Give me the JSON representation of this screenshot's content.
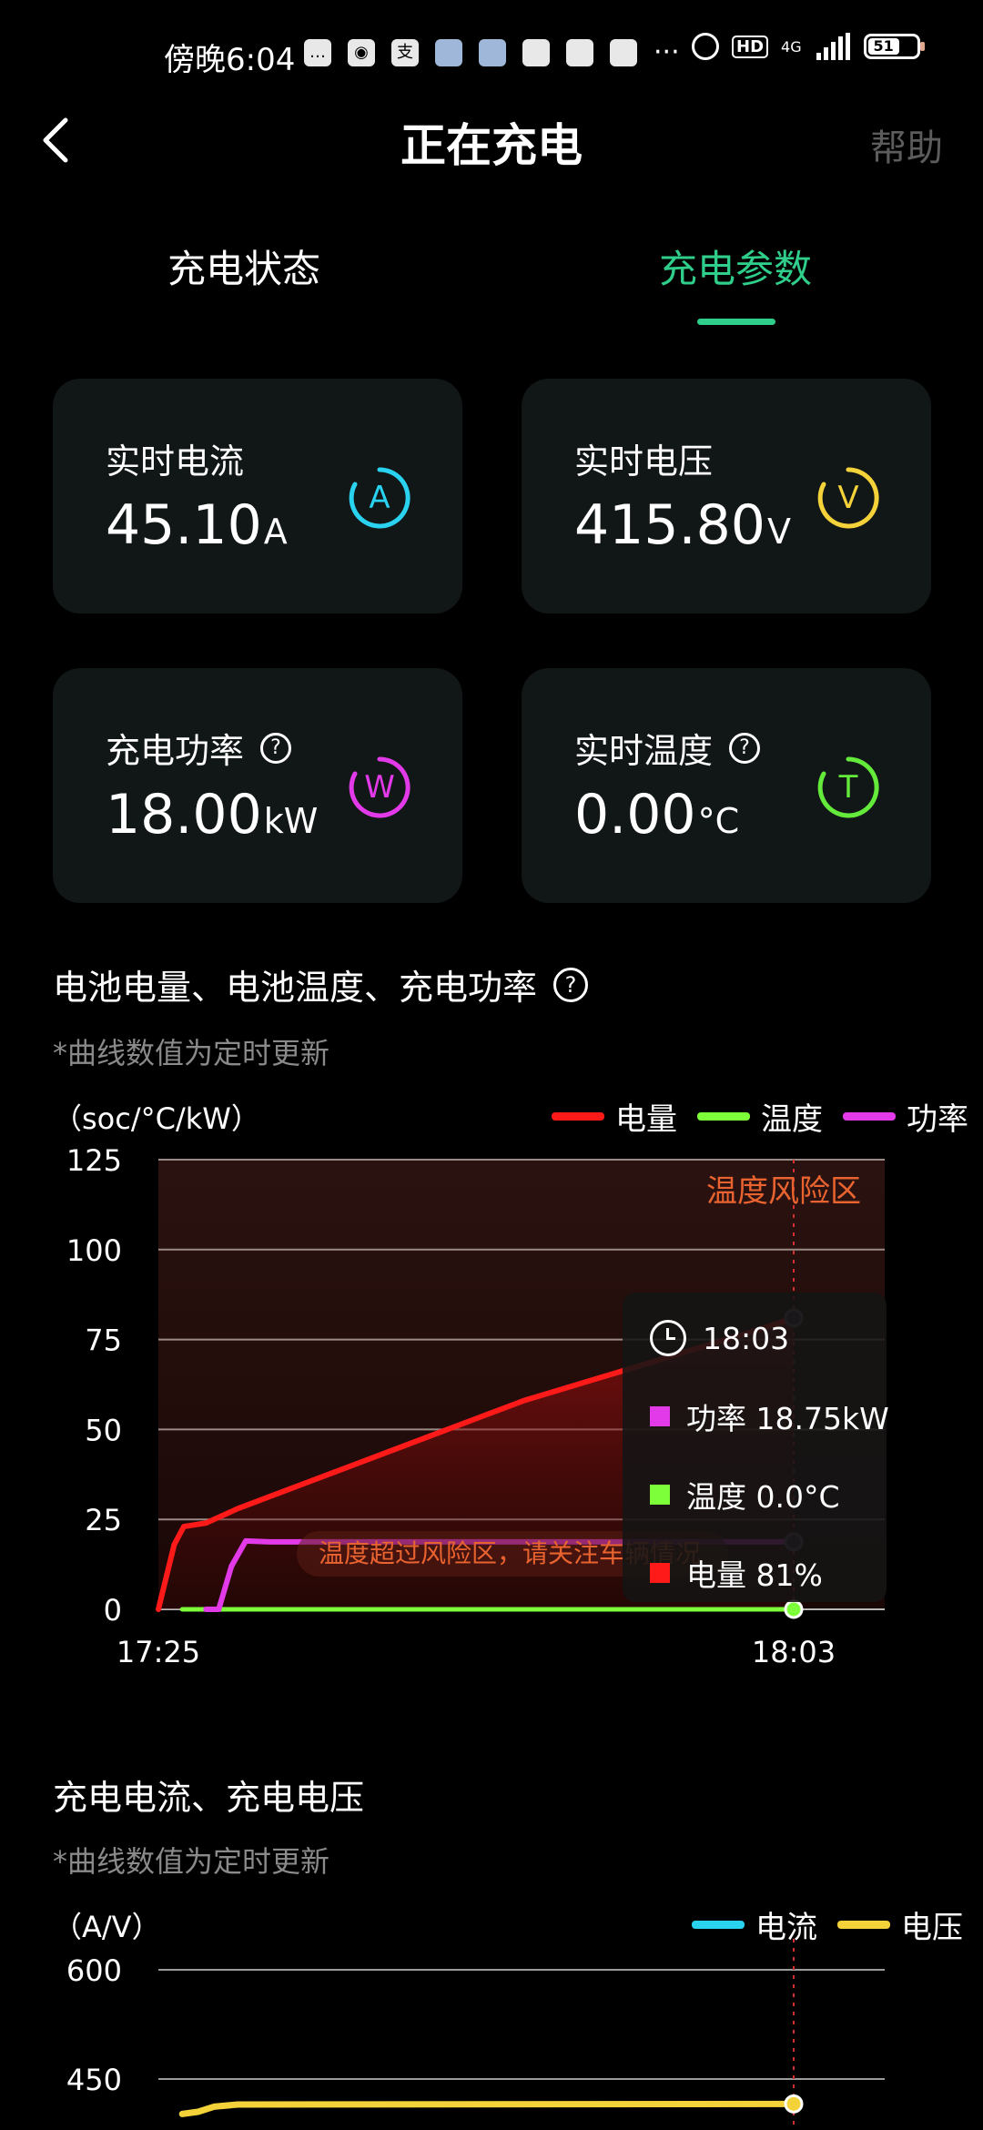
{
  "status_bar": {
    "time": "傍晚6:04",
    "network": "4G",
    "hd": "HD",
    "battery_level": "51"
  },
  "header": {
    "title": "正在充电",
    "help": "帮助"
  },
  "tabs": [
    {
      "label": "充电状态",
      "active": false
    },
    {
      "label": "充电参数",
      "active": true
    }
  ],
  "cards": {
    "current": {
      "label": "实时电流",
      "value": "45.10",
      "unit": "A",
      "icon": "A",
      "color": "#29d3f0"
    },
    "voltage": {
      "label": "实时电压",
      "value": "415.80",
      "unit": "V",
      "icon": "V",
      "color": "#f4d23a"
    },
    "power": {
      "label": "充电功率",
      "value": "18.00",
      "unit": "kW",
      "icon": "W",
      "color": "#e23ae8"
    },
    "temperature": {
      "label": "实时温度",
      "value": "0.00",
      "unit": "°C",
      "icon": "T",
      "color": "#63ea3a"
    }
  },
  "section1": {
    "title": "电池电量、电池温度、充电功率",
    "note": "*曲线数值为定时更新",
    "unit": "（soc/°C/kW）",
    "risk_zone_label": "温度风险区",
    "warning": "温度超过风险区，请关注车辆情况",
    "tooltip": {
      "time": "18:03",
      "power": "功率 18.75kW",
      "temperature": "温度 0.0°C",
      "soc": "电量 81%"
    }
  },
  "section2": {
    "title": "充电电流、充电电压",
    "note": "*曲线数值为定时更新",
    "unit": "（A/V）"
  },
  "chart_data": [
    {
      "type": "line",
      "xlabel": "",
      "ylabel": "（soc/°C/kW）",
      "x_ticks": [
        "17:25",
        "18:03"
      ],
      "y_ticks": [
        0,
        25,
        50,
        75,
        100,
        125
      ],
      "ylim": [
        0,
        125
      ],
      "xlim_minutes": [
        0,
        40
      ],
      "colors": {
        "电量": "#ff1a1a",
        "温度": "#7dff3a",
        "功率": "#e23ae8"
      },
      "series": [
        {
          "name": "电量",
          "x": [
            0,
            1,
            1.6,
            3,
            5,
            8,
            11,
            14,
            17,
            20,
            23,
            26,
            29,
            32,
            35,
            38,
            40
          ],
          "y": [
            0,
            18,
            23,
            24,
            28,
            33,
            38,
            43,
            48,
            53,
            58,
            62,
            66,
            70,
            74,
            78,
            81
          ]
        },
        {
          "name": "温度",
          "x": [
            1.5,
            40
          ],
          "y": [
            0,
            0
          ]
        },
        {
          "name": "功率",
          "x": [
            3,
            3.8,
            4.6,
            5.5,
            7,
            40
          ],
          "y": [
            0,
            0,
            12,
            19,
            18.75,
            18.75
          ]
        }
      ]
    },
    {
      "type": "line",
      "ylabel": "（A/V）",
      "y_ticks": [
        450,
        600
      ],
      "ylim": [
        300,
        600
      ],
      "colors": {
        "电流": "#29d3f0",
        "电压": "#f4d23a"
      },
      "series": [
        {
          "name": "电压",
          "x": [
            1.5,
            2.5,
            3.5,
            5,
            40
          ],
          "y": [
            402,
            405,
            412,
            415,
            415.8
          ]
        }
      ]
    }
  ]
}
